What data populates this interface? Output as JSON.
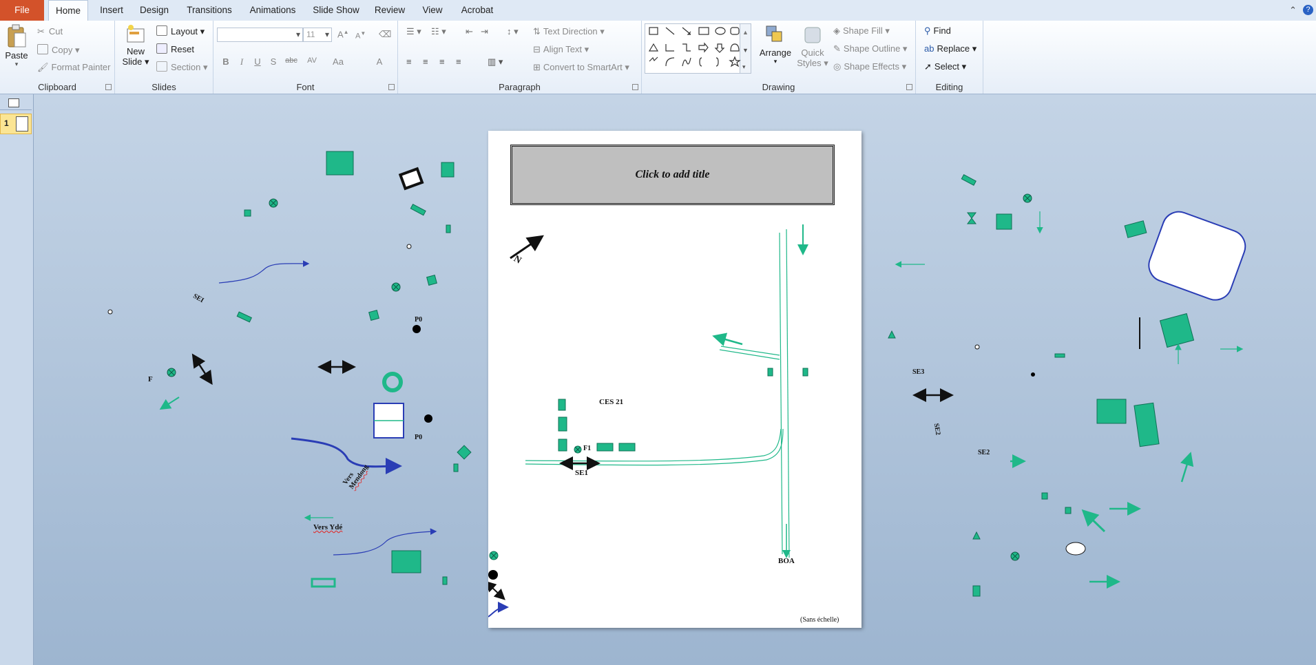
{
  "tabs": {
    "file": "File",
    "home": "Home",
    "insert": "Insert",
    "design": "Design",
    "transitions": "Transitions",
    "animations": "Animations",
    "slideshow": "Slide Show",
    "review": "Review",
    "view": "View",
    "acrobat": "Acrobat"
  },
  "clipboard": {
    "paste": "Paste",
    "cut": "Cut",
    "copy": "Copy",
    "format_painter": "Format Painter",
    "label": "Clipboard"
  },
  "slides_group": {
    "new_slide_1": "New",
    "new_slide_2": "Slide",
    "layout": "Layout",
    "reset": "Reset",
    "section": "Section",
    "label": "Slides"
  },
  "font_group": {
    "font_size": "11",
    "bold": "B",
    "italic": "I",
    "underline": "U",
    "shadow": "S",
    "strike": "abc",
    "spacing": "AV",
    "case": "Aa",
    "color": "A",
    "label": "Font"
  },
  "paragraph": {
    "text_direction": "Text Direction",
    "align_text": "Align Text",
    "convert_smartart": "Convert to SmartArt",
    "label": "Paragraph"
  },
  "drawing": {
    "arrange": "Arrange",
    "quick_styles_1": "Quick",
    "quick_styles_2": "Styles",
    "shape_fill": "Shape Fill",
    "shape_outline": "Shape Outline",
    "shape_effects": "Shape Effects",
    "label": "Drawing"
  },
  "editing": {
    "find": "Find",
    "replace": "Replace",
    "select": "Select",
    "label": "Editing"
  },
  "thumbnails": {
    "slide_number": "1"
  },
  "slide": {
    "title_placeholder": "Click to add title",
    "north": "N",
    "ces": "CES 21",
    "f1": "F1",
    "se1": "SE1",
    "boa": "BOA",
    "scale_note": "(Sans échelle)"
  },
  "offslide": {
    "sei": "SEI",
    "f": "F",
    "p0_top": "P0",
    "p0_bottom": "P0",
    "vers_mendong_1": "Vers",
    "vers_mendong_2": "Mendong",
    "vers_yde": "Vers Ydé",
    "se3": "SE3",
    "se2_rotated": "SE2",
    "se2": "SE2"
  },
  "colors": {
    "teal": "#1fb889",
    "teal_dark": "#0f7055",
    "blue_line": "#2a3db5",
    "file_tab": "#d3522a"
  }
}
